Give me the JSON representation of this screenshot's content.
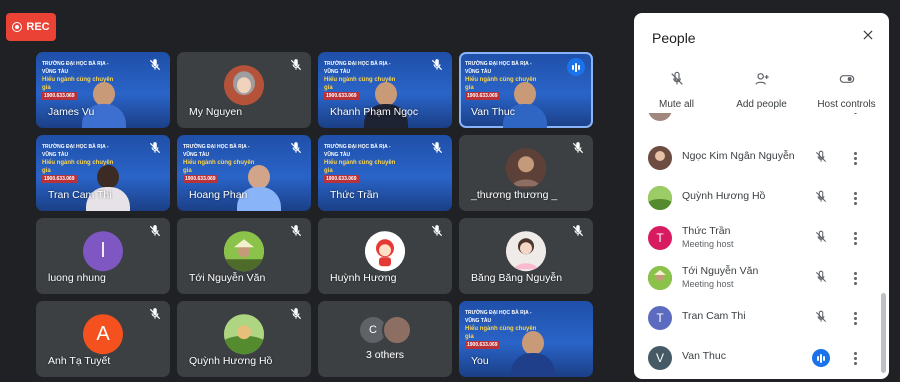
{
  "rec": {
    "label": "REC",
    "color": "#ea4335"
  },
  "grid": {
    "tiles": [
      {
        "name": "James Vu",
        "type": "video"
      },
      {
        "name": "My Nguyen",
        "type": "avatar"
      },
      {
        "name": "Khanh Phạm Ngọc",
        "type": "video"
      },
      {
        "name": "Van Thuc",
        "type": "video",
        "speaking": true
      },
      {
        "name": "Tran Cam Thi",
        "type": "video"
      },
      {
        "name": "Hoang Phan",
        "type": "video"
      },
      {
        "name": "Thức Trần",
        "type": "video"
      },
      {
        "name": "_thương thương _",
        "type": "avatar"
      },
      {
        "name": "luong nhung",
        "type": "avatar",
        "initial": "l",
        "color": "#7e57c2"
      },
      {
        "name": "Tới Nguyễn Văn",
        "type": "avatar"
      },
      {
        "name": "Huỳnh Hương",
        "type": "avatar"
      },
      {
        "name": "Băng Băng Nguyễn",
        "type": "avatar"
      },
      {
        "name": "Anh Tạ Tuyết",
        "type": "avatar",
        "initial": "A",
        "color": "#f4511e"
      },
      {
        "name": "Quỳnh Hương Hồ",
        "type": "avatar"
      },
      {
        "name": "3 others",
        "type": "others",
        "initial": "C"
      },
      {
        "name": "You",
        "type": "video"
      }
    ]
  },
  "panel": {
    "title": "People",
    "actions": [
      {
        "label": "Mute all",
        "icon": "mic-off-icon"
      },
      {
        "label": "Add people",
        "icon": "add-person-icon"
      },
      {
        "label": "Host controls",
        "icon": "toggle-icon"
      }
    ],
    "people": [
      {
        "name": "Ngọc Kim Ngân Nguyễn",
        "sub": "",
        "avatar": "photo",
        "color": "#8d6e63",
        "status": "muted"
      },
      {
        "name": "Quỳnh Hương Hồ",
        "sub": "",
        "avatar": "photo",
        "color": "#6d8b3a",
        "status": "muted"
      },
      {
        "name": "Thức Trần",
        "sub": "Meeting host",
        "avatar": "T",
        "color": "#d81b60",
        "status": "muted"
      },
      {
        "name": "Tới Nguyễn Văn",
        "sub": "Meeting host",
        "avatar": "photo",
        "color": "#5d7d4a",
        "status": "muted"
      },
      {
        "name": "Tran Cam Thi",
        "sub": "",
        "avatar": "T",
        "color": "#5c6bc0",
        "status": "muted"
      },
      {
        "name": "Van Thuc",
        "sub": "",
        "avatar": "V",
        "color": "#455a64",
        "status": "speaking"
      }
    ]
  },
  "banner": {
    "line1": "TRƯỜNG ĐẠI HỌC BÀ RỊA - VŨNG TÀU",
    "line2": "Hiểu ngành cùng chuyên gia",
    "phone": "1900.633.069"
  }
}
